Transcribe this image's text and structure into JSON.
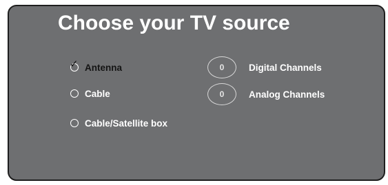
{
  "screen": {
    "title": "Choose your TV source"
  },
  "sources": [
    {
      "label": "Antenna",
      "selected": true,
      "check_glyph": "✓"
    },
    {
      "label": "Cable",
      "selected": false
    },
    {
      "label": "Cable/Satellite box",
      "selected": false
    }
  ],
  "channels": [
    {
      "count": "0",
      "label": "Digital Channels"
    },
    {
      "count": "0",
      "label": "Analog Channels"
    }
  ],
  "colors": {
    "panel_background": "#6e6f71",
    "panel_border": "#1e1e1e",
    "text": "#ffffff",
    "selected_text": "#141414"
  },
  "icons": {
    "unselected": "radio-empty-icon",
    "selected": "checkmark-icon"
  }
}
